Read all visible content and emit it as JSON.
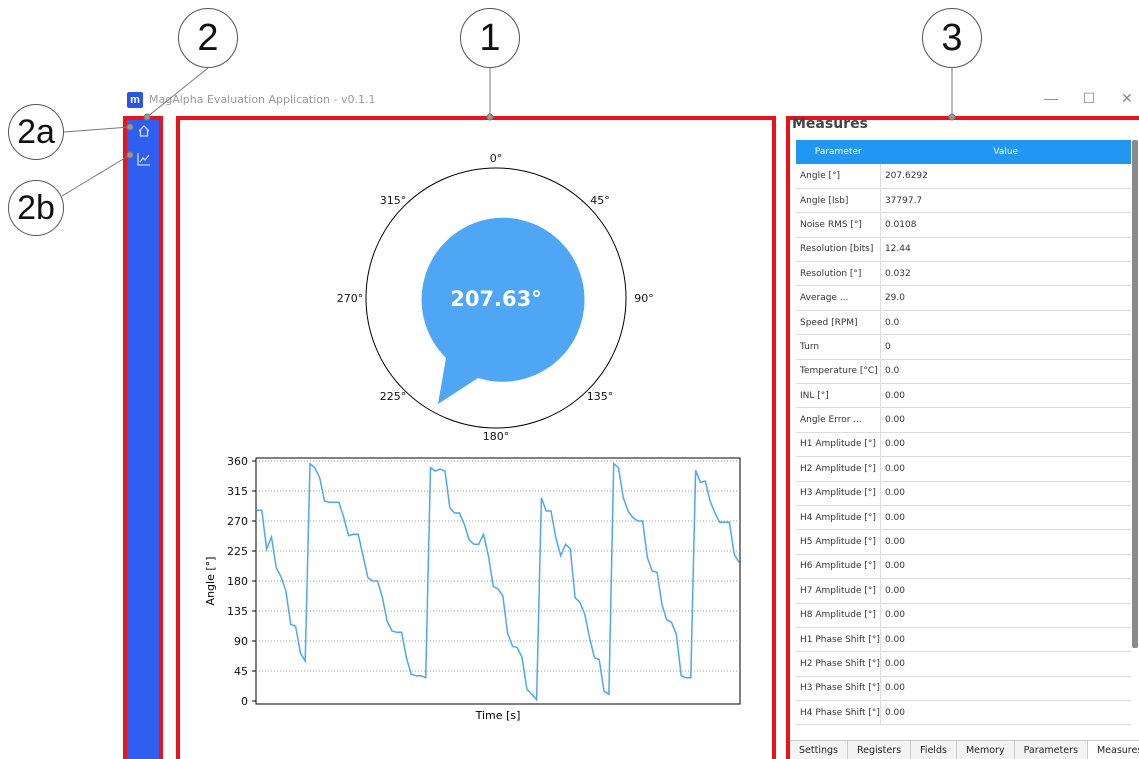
{
  "window": {
    "title": "MagAlpha Evaluation Application - v0.1.1",
    "logo_letter": "m",
    "minimize": "—",
    "maximize": "☐",
    "close": "✕"
  },
  "callouts": {
    "c1": "1",
    "c2": "2",
    "c2a": "2a",
    "c2b": "2b",
    "c3": "3"
  },
  "sidebar": {
    "items": [
      {
        "icon": "home-icon"
      },
      {
        "icon": "chart-line-icon"
      }
    ]
  },
  "dial": {
    "value_label": "207.63°",
    "angle_value": 207.63,
    "tick_labels": [
      "0°",
      "45°",
      "90°",
      "135°",
      "180°",
      "225°",
      "270°",
      "315°"
    ]
  },
  "chart_data": {
    "type": "line",
    "xlabel": "Time [s]",
    "ylabel": "Angle [°]",
    "ylim": [
      0,
      360
    ],
    "yticks": [
      0,
      45,
      90,
      135,
      180,
      225,
      270,
      315,
      360
    ],
    "grid": "horizontal-dotted",
    "series": [
      {
        "values": [
          286,
          286,
          228,
          246,
          200,
          186,
          165,
          115,
          112,
          72,
          60,
          356,
          350,
          335,
          300,
          298,
          298,
          298,
          275,
          248,
          250,
          250,
          218,
          185,
          180,
          180,
          156,
          120,
          105,
          103,
          103,
          65,
          40,
          38,
          38,
          35,
          350,
          345,
          348,
          345,
          290,
          282,
          282,
          265,
          242,
          235,
          235,
          250,
          218,
          172,
          168,
          158,
          102,
          82,
          80,
          65,
          18,
          10,
          2,
          305,
          285,
          285,
          245,
          218,
          235,
          228,
          155,
          148,
          130,
          95,
          65,
          62,
          15,
          10,
          356,
          350,
          305,
          285,
          275,
          270,
          270,
          215,
          195,
          193,
          145,
          122,
          118,
          100,
          38,
          35,
          35,
          346,
          328,
          330,
          300,
          282,
          268,
          268,
          268,
          220,
          208
        ]
      }
    ]
  },
  "measures": {
    "title": "Measures",
    "columns": [
      "Parameter",
      "Value"
    ],
    "rows": [
      [
        "Angle [°]",
        "207.6292"
      ],
      [
        "Angle [lsb]",
        "37797.7"
      ],
      [
        "Noise RMS [°]",
        "0.0108"
      ],
      [
        "Resolution [bits]",
        "12.44"
      ],
      [
        "Resolution [°]",
        "0.032"
      ],
      [
        "Average ...",
        "29.0"
      ],
      [
        "Speed [RPM]",
        "0.0"
      ],
      [
        "Turn",
        "0"
      ],
      [
        "Temperature [°C]",
        "0.0"
      ],
      [
        "INL [°]",
        "0.00"
      ],
      [
        "Angle Error ...",
        "0.00"
      ],
      [
        "H1 Amplitude [°]",
        "0.00"
      ],
      [
        "H2 Amplitude [°]",
        "0.00"
      ],
      [
        "H3 Amplitude [°]",
        "0.00"
      ],
      [
        "H4 Amplitude [°]",
        "0.00"
      ],
      [
        "H5 Amplitude [°]",
        "0.00"
      ],
      [
        "H6 Amplitude [°]",
        "0.00"
      ],
      [
        "H7 Amplitude [°]",
        "0.00"
      ],
      [
        "H8 Amplitude [°]",
        "0.00"
      ],
      [
        "H1 Phase Shift [°]",
        "0.00"
      ],
      [
        "H2 Phase Shift [°]",
        "0.00"
      ],
      [
        "H3 Phase Shift [°]",
        "0.00"
      ],
      [
        "H4 Phase Shift [°]",
        "0.00"
      ]
    ]
  },
  "tabs": [
    "Settings",
    "Registers",
    "Fields",
    "Memory",
    "Parameters",
    "Measures"
  ],
  "active_tab": "Measures",
  "colors": {
    "accent_blue": "#2196f3",
    "sidebar_blue": "#2f5ff0",
    "highlight_red": "#e8141b",
    "dial_fill": "#4ea6f5"
  }
}
